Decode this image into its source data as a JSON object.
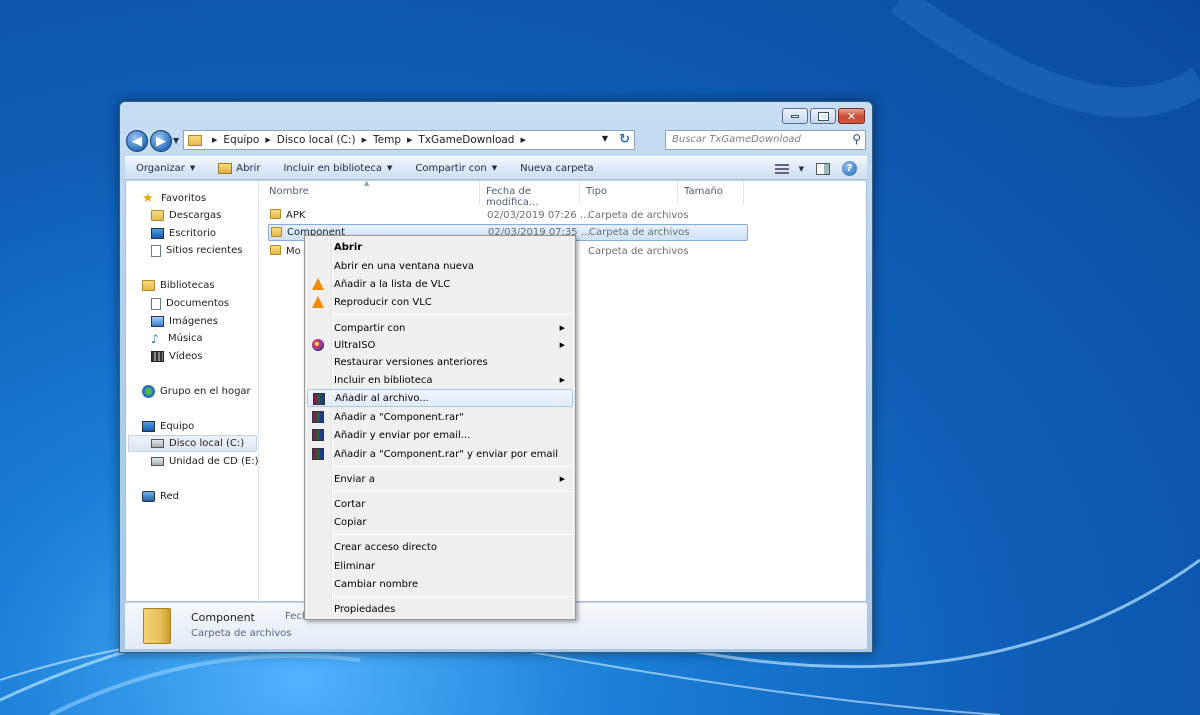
{
  "window": {
    "address": {
      "crumbs": [
        "Equipo",
        "Disco local (C:)",
        "Temp",
        "TxGameDownload"
      ]
    },
    "search_placeholder": "Buscar TxGameDownload",
    "toolbar": {
      "organize": "Organizar",
      "open": "Abrir",
      "include_library": "Incluir en biblioteca",
      "share_with": "Compartir con",
      "new_folder": "Nueva carpeta"
    },
    "nav": {
      "favorites": "Favoritos",
      "downloads": "Descargas",
      "desktop": "Escritorio",
      "recent": "Sitios recientes",
      "libraries": "Bibliotecas",
      "documents": "Documentos",
      "images": "Imágenes",
      "music": "Música",
      "videos": "Vídeos",
      "homegroup": "Grupo en el hogar",
      "computer": "Equipo",
      "local_disk": "Disco local (C:)",
      "cd_drive": "Unidad de CD (E:)",
      "network": "Red"
    },
    "columns": {
      "name": "Nombre",
      "date": "Fecha de modifica...",
      "type": "Tipo",
      "size": "Tamaño"
    },
    "files": [
      {
        "name": "APK",
        "date": "02/03/2019 07:26 ...",
        "type": "Carpeta de archivos"
      },
      {
        "name": "Component",
        "date": "02/03/2019 07:35 ...",
        "type": "Carpeta de archivos"
      },
      {
        "name": "Mo",
        "date": "",
        "type": "Carpeta de archivos"
      }
    ],
    "details": {
      "name": "Component",
      "type": "Carpeta de archivos",
      "date_label": "Fech"
    }
  },
  "context_menu": {
    "items": [
      "Abrir",
      "Abrir en una ventana nueva",
      "Añadir a la lista de VLC",
      "Reproducir con VLC",
      "Compartir con",
      "UltraISO",
      "Restaurar versiones anteriores",
      "Incluir en biblioteca",
      "Añadir al archivo...",
      "Añadir a \"Component.rar\"",
      "Añadir y enviar por email...",
      "Añadir a \"Component.rar\" y enviar por email",
      "Enviar a",
      "Cortar",
      "Copiar",
      "Crear acceso directo",
      "Eliminar",
      "Cambiar nombre",
      "Propiedades"
    ]
  }
}
